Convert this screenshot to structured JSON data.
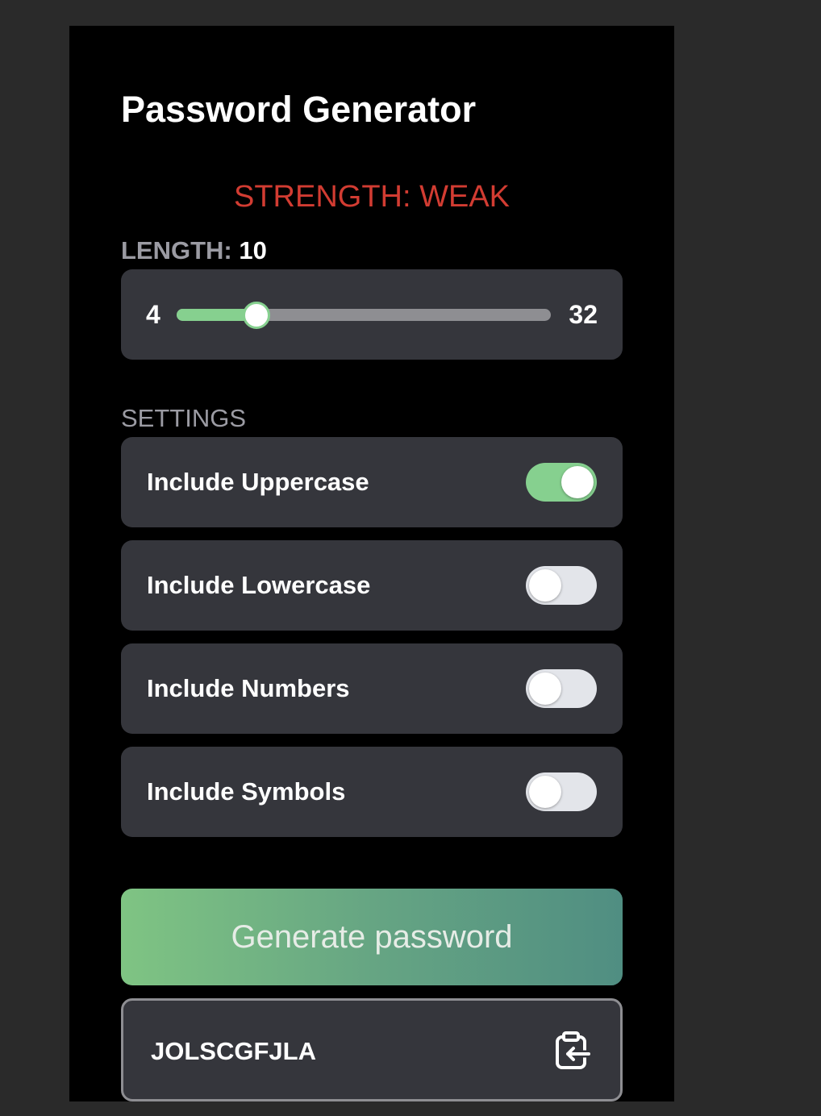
{
  "app": {
    "title": "Password Generator"
  },
  "strength": {
    "label": "STRENGTH: ",
    "value": "WEAK",
    "color": "#d23c32"
  },
  "length": {
    "label": "LENGTH: ",
    "value": "10",
    "min": "4",
    "max": "32",
    "current": 10,
    "min_value": 4,
    "max_value": 32,
    "accent": "#86d08f"
  },
  "settings": {
    "label": "SETTINGS",
    "options": [
      {
        "label": "Include Uppercase",
        "enabled": true
      },
      {
        "label": "Include Lowercase",
        "enabled": false
      },
      {
        "label": "Include Numbers",
        "enabled": false
      },
      {
        "label": "Include Symbols",
        "enabled": false
      }
    ]
  },
  "generate": {
    "label": "Generate password"
  },
  "output": {
    "password": "JOLSCGFJLA",
    "copy_icon": "clipboard-copy-icon"
  },
  "colors": {
    "background": "#2a2a2a",
    "panel": "#000000",
    "card": "#35363c",
    "toggle_on": "#86d08f",
    "toggle_off": "#e3e5ea"
  }
}
